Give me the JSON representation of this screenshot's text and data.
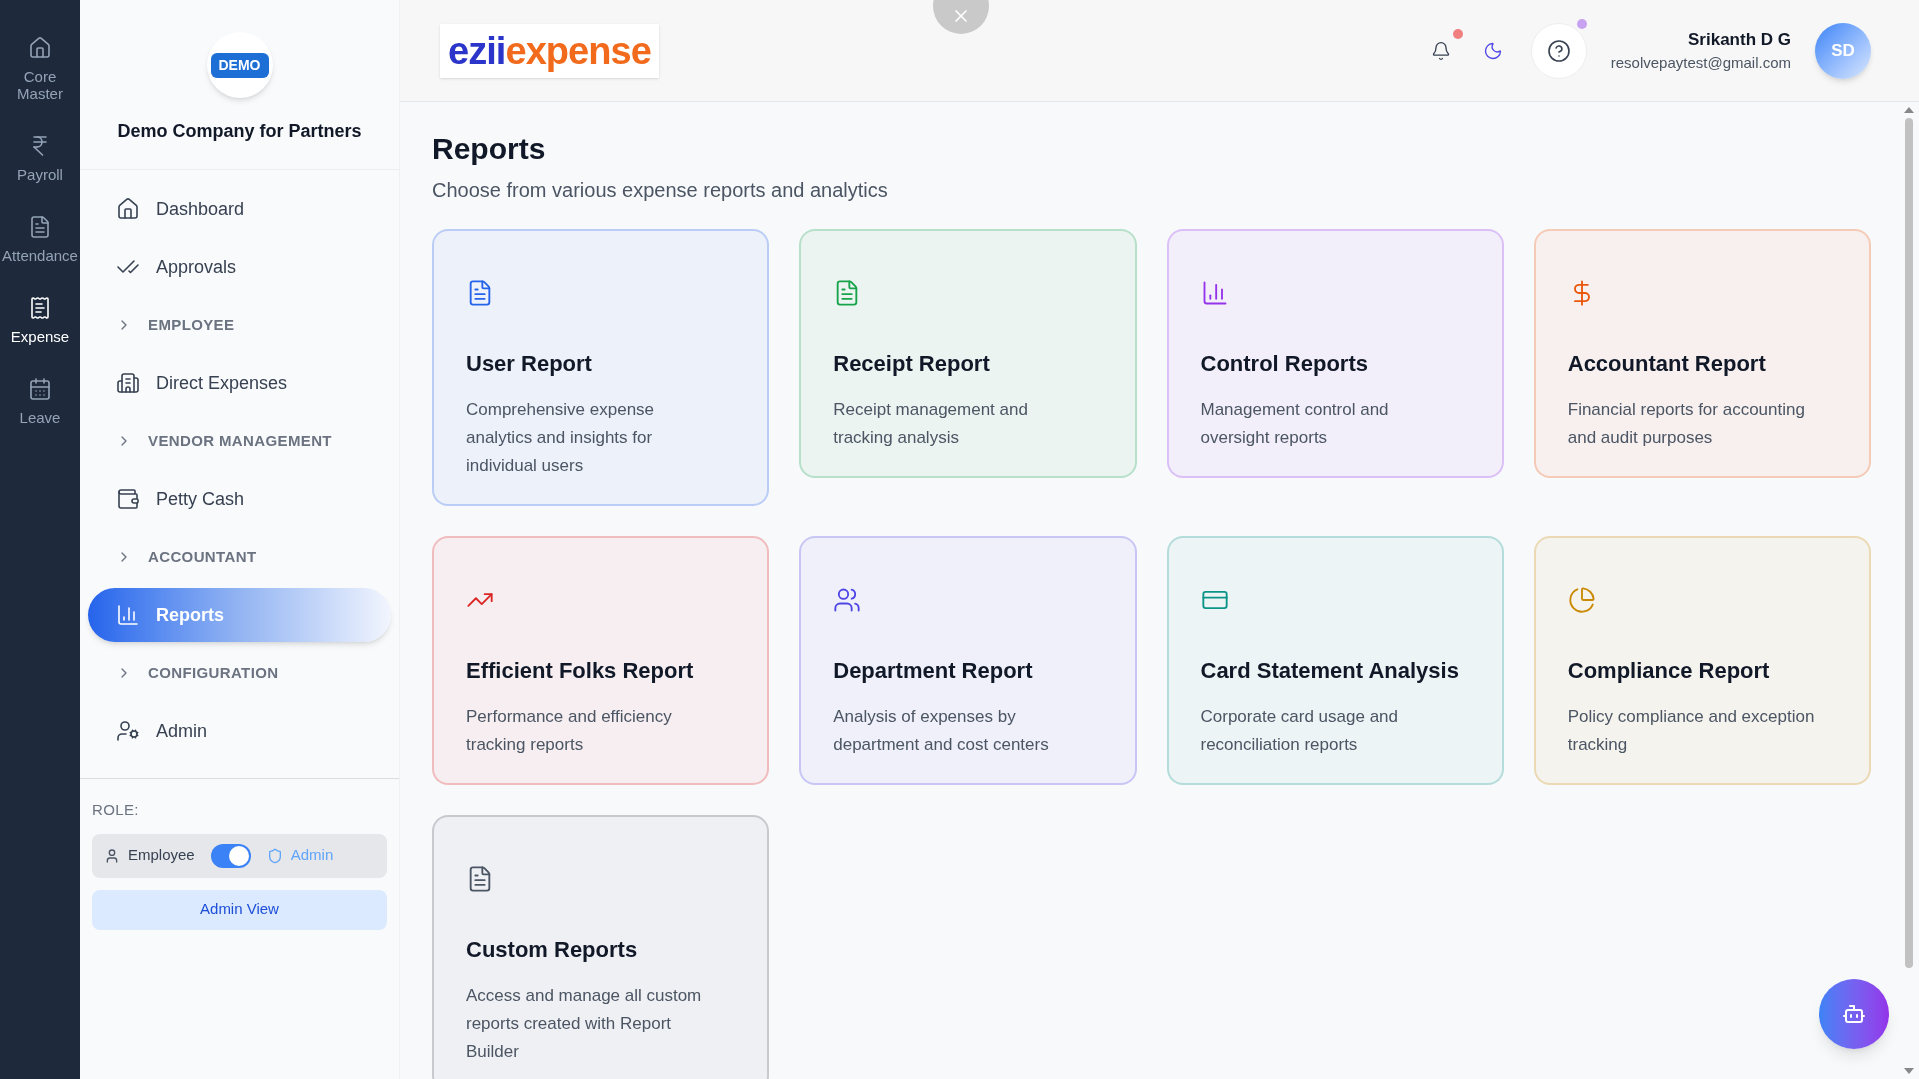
{
  "rail": [
    {
      "label": "Core Master",
      "selected": false
    },
    {
      "label": "Payroll",
      "selected": false
    },
    {
      "label": "Attendance",
      "selected": false
    },
    {
      "label": "Expense",
      "selected": true
    },
    {
      "label": "Leave",
      "selected": false
    }
  ],
  "company": {
    "badge": "DEMO",
    "name": "Demo Company for Partners"
  },
  "nav": [
    {
      "kind": "link",
      "label": "Dashboard",
      "selected": false
    },
    {
      "kind": "link",
      "label": "Approvals",
      "selected": false
    },
    {
      "kind": "section",
      "label": "EMPLOYEE",
      "selected": false
    },
    {
      "kind": "link",
      "label": "Direct Expenses",
      "selected": false
    },
    {
      "kind": "section",
      "label": "VENDOR MANAGEMENT",
      "selected": false
    },
    {
      "kind": "link",
      "label": "Petty Cash",
      "selected": false
    },
    {
      "kind": "section",
      "label": "ACCOUNTANT",
      "selected": false
    },
    {
      "kind": "link",
      "label": "Reports",
      "selected": true
    },
    {
      "kind": "section",
      "label": "CONFIGURATION",
      "selected": false
    },
    {
      "kind": "link",
      "label": "Admin",
      "selected": false
    }
  ],
  "role": {
    "label": "ROLE:",
    "left": "Employee",
    "right": "Admin",
    "on": true,
    "view_button": "Admin View"
  },
  "header": {
    "logo_part_1": "ezii",
    "logo_part_2": "expense",
    "notifications_dot": true,
    "help_dot": true,
    "user_name": "Srikanth D G",
    "user_email": "resolvepaytest@gmail.com",
    "avatar": "SD"
  },
  "page": {
    "title": "Reports",
    "subtitle": "Choose from various expense reports and analytics"
  },
  "cards": [
    {
      "title": "User Report",
      "description": "Comprehensive expense analytics and insights for individual users",
      "color": "#2563eb"
    },
    {
      "title": "Receipt Report",
      "description": "Receipt management and tracking analysis",
      "color": "#16a34a"
    },
    {
      "title": "Control Reports",
      "description": "Management control and oversight reports",
      "color": "#9333ea"
    },
    {
      "title": "Accountant Report",
      "description": "Financial reports for accounting and audit purposes",
      "color": "#ea580c"
    },
    {
      "title": "Efficient Folks Report",
      "description": "Performance and efficiency tracking reports",
      "color": "#dc2626"
    },
    {
      "title": "Department Report",
      "description": "Analysis of expenses by department and cost centers",
      "color": "#4f46e5"
    },
    {
      "title": "Card Statement Analysis",
      "description": "Corporate card usage and reconciliation reports",
      "color": "#0d9488"
    },
    {
      "title": "Compliance Report",
      "description": "Policy compliance and exception tracking",
      "color": "#ca8a04"
    },
    {
      "title": "Custom Reports",
      "description": "Access and manage all custom reports created with Report Builder",
      "color": "#4b5563"
    }
  ]
}
